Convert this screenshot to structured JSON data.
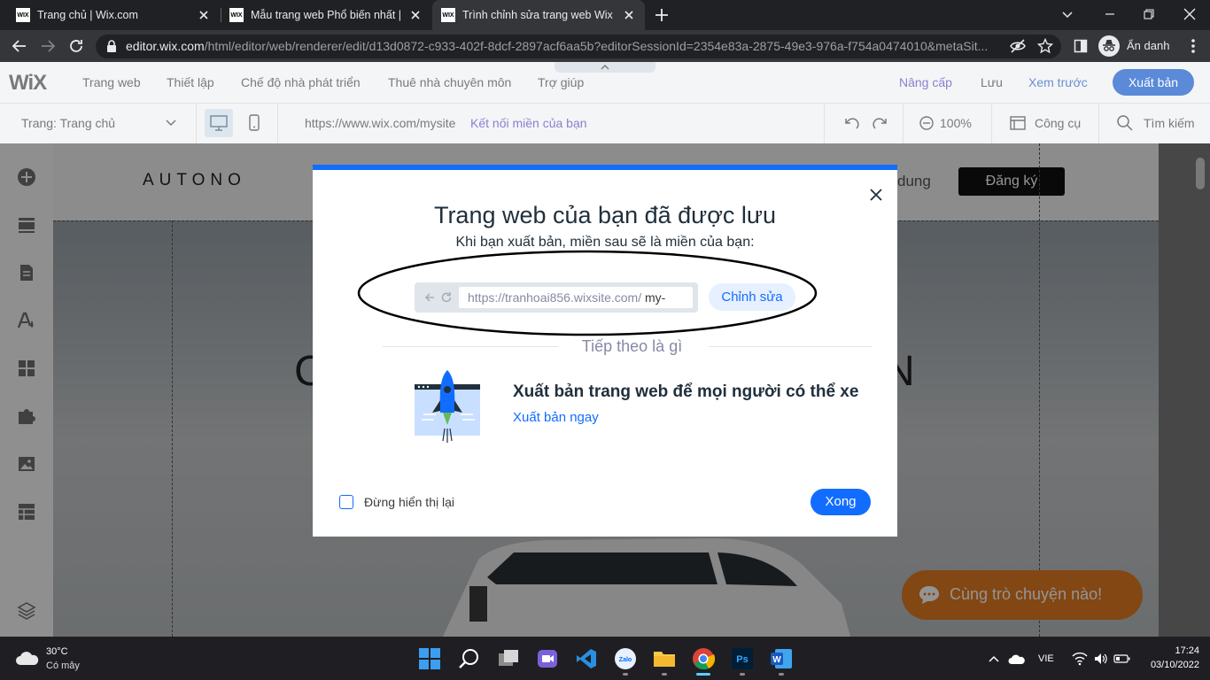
{
  "browser": {
    "tabs": [
      {
        "favicon": "WIX",
        "title": "Trang chủ | Wix.com"
      },
      {
        "favicon": "WIX",
        "title": "Mẫu trang web Phổ biến nhất | W"
      },
      {
        "favicon": "WIX",
        "title": "Trình chỉnh sửa trang web Wix | n"
      }
    ],
    "url_host": "editor.wix.com",
    "url_path": "/html/editor/web/renderer/edit/d13d0872-c933-402f-8dcf-2897acf6aa5b?editorSessionId=2354e83a-2875-49e3-976a-f754a0474010&metaSit...",
    "profile_label": "Ẩn danh"
  },
  "wix": {
    "logo": "WiX",
    "menu": [
      "Trang web",
      "Thiết lập",
      "Chế độ nhà phát triển",
      "Thuê nhà chuyên môn",
      "Trợ giúp"
    ],
    "upgrade": "Nâng cấp",
    "save": "Lưu",
    "preview": "Xem trước",
    "publish": "Xuất bản",
    "page_selector": "Trang: Trang chủ",
    "site_url": "https://www.wix.com/mysite",
    "connect_domain": "Kết nối miền của bạn",
    "zoom": "100%",
    "tools": "Công cụ",
    "search": "Tìm kiếm"
  },
  "site": {
    "brand": "AUTONO",
    "nav_partial": "dung",
    "signup": "Đăng ký",
    "chat": "Cùng trò chuyện nào!",
    "hero_left": "C",
    "hero_right": "N"
  },
  "modal": {
    "title": "Trang web của bạn đã được lưu",
    "subtitle": "Khi bạn xuất bản, miền sau sẽ là miền của bạn:",
    "url_prefix": "https://tranhoai856.wixsite.com/",
    "url_slug": " my-",
    "edit_button": "Chỉnh sửa",
    "next_heading": "Tiếp theo là gì",
    "publish_title": "Xuất bản trang web để mọi người có thể xe",
    "publish_link": "Xuất bản ngay",
    "dont_show": "Đừng hiển thị lại",
    "done": "Xong",
    "accent_color": "#116dff"
  },
  "taskbar": {
    "temperature": "30°C",
    "weather": "Có mây",
    "language": "VIE",
    "time": "17:24",
    "date": "03/10/2022"
  }
}
